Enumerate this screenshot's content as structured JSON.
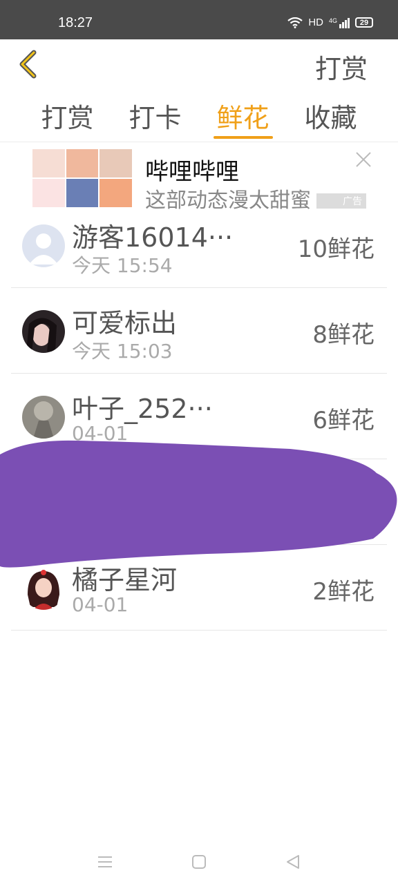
{
  "status_bar": {
    "time": "18:27",
    "network": "HD",
    "signal_label": "4G",
    "battery": "29"
  },
  "nav": {
    "action_label": "打赏"
  },
  "tabs": [
    {
      "label": "打赏",
      "active": false
    },
    {
      "label": "打卡",
      "active": false
    },
    {
      "label": "鲜花",
      "active": true
    },
    {
      "label": "收藏",
      "active": false
    }
  ],
  "ad": {
    "title": "哔哩哔哩",
    "description": "这部动态漫太甜蜜",
    "badge": "广告"
  },
  "list": [
    {
      "name": "游客16014···",
      "time": "今天  15:54",
      "amount": "10鲜花"
    },
    {
      "name": "可爱标出",
      "time": "今天  15:03",
      "amount": "8鲜花"
    },
    {
      "name": "叶子_252···",
      "time": "04-01",
      "amount": "6鲜花"
    },
    {
      "name": "",
      "time": "",
      "amount": ""
    },
    {
      "name": "橘子星河",
      "time": "04-01",
      "amount": "2鲜花"
    }
  ],
  "colors": {
    "accent": "#f0a019",
    "scribble": "#7b4fb4"
  }
}
